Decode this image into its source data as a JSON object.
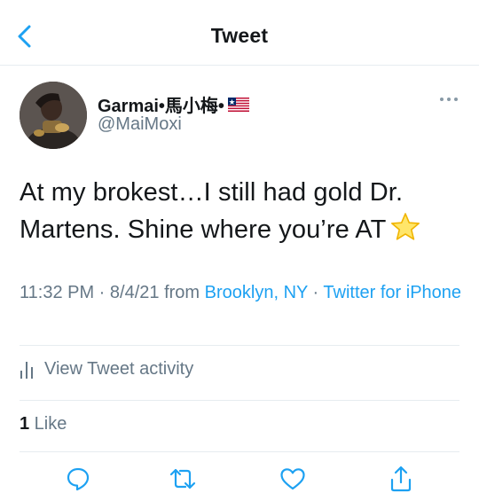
{
  "nav": {
    "title": "Tweet"
  },
  "author": {
    "display_name": "Garmai•馬小梅•",
    "handle": "@MaiMoxi"
  },
  "tweet": {
    "line1": "At my brokest…I still had gold Dr.",
    "line2": "Martens. Shine where you’re AT"
  },
  "meta": {
    "time": "11:32 PM",
    "sep1": " · ",
    "date": "8/4/21",
    "from": " from ",
    "location": "Brooklyn, NY",
    "sep2": " · ",
    "source": "Twitter for iPhone"
  },
  "activity": {
    "label": "View Tweet activity"
  },
  "stats": {
    "like_count": "1",
    "like_label": " Like"
  },
  "icons": {
    "back": "chevron-left-icon",
    "more": "more-dots-icon",
    "flag": "liberia-flag-icon",
    "star": "star-emoji-icon",
    "activity": "bar-chart-icon",
    "reply": "reply-icon",
    "retweet": "retweet-icon",
    "like": "heart-icon",
    "share": "share-icon"
  },
  "colors": {
    "accent": "#1da1f2",
    "secondary_text": "#657786",
    "divider": "#e6ecf0"
  }
}
